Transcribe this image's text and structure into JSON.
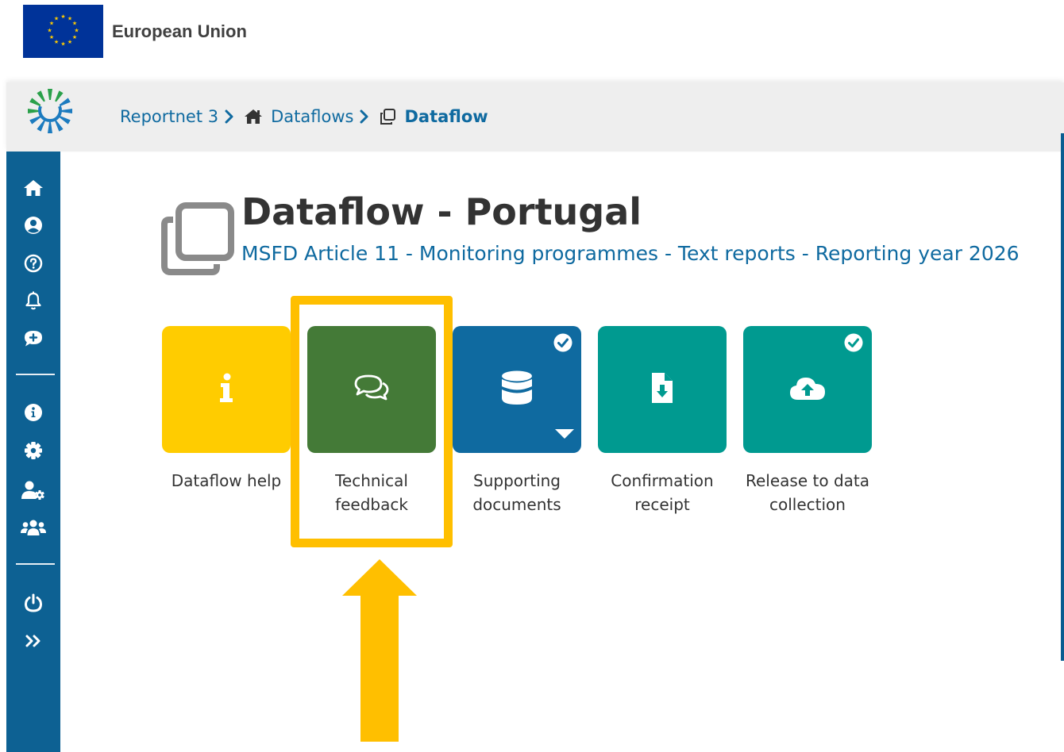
{
  "eu_bar": {
    "title": "European Union"
  },
  "breadcrumb": {
    "items": [
      {
        "label": "Reportnet 3",
        "icon": "none"
      },
      {
        "label": "Dataflows",
        "icon": "home-icon"
      },
      {
        "label": "Dataflow",
        "icon": "copy-icon"
      }
    ]
  },
  "sidebar": {
    "items": [
      {
        "name": "home-icon"
      },
      {
        "name": "user-circle-icon"
      },
      {
        "name": "question-circle-icon"
      },
      {
        "name": "bell-icon"
      },
      {
        "name": "comment-plus-icon"
      },
      {
        "name": "info-circle-icon"
      },
      {
        "name": "gear-icon"
      },
      {
        "name": "user-cog-icon"
      },
      {
        "name": "users-icon"
      },
      {
        "name": "power-icon"
      },
      {
        "name": "double-chevron-right-icon"
      }
    ]
  },
  "page": {
    "title": "Dataflow - Portugal",
    "subtitle": "MSFD Article 11 - Monitoring programmes - Text reports - Reporting year 2026"
  },
  "tiles": [
    {
      "label": "Dataflow help",
      "color": "#ffcc00",
      "icon": "info-icon",
      "check": false,
      "dropdown": false
    },
    {
      "label": "Technical feedback",
      "color": "#447a37",
      "icon": "comments-icon",
      "check": false,
      "dropdown": false
    },
    {
      "label": "Supporting documents",
      "color": "#0f6aa0",
      "icon": "database-icon",
      "check": true,
      "dropdown": true
    },
    {
      "label": "Confirmation receipt",
      "color": "#009a90",
      "icon": "file-download-icon",
      "check": false,
      "dropdown": false
    },
    {
      "label": "Release to data collection",
      "color": "#009a90",
      "icon": "cloud-upload-icon",
      "check": true,
      "dropdown": false
    }
  ],
  "colors": {
    "highlight": "#ffbf00",
    "sidebar": "#0d6193",
    "link": "#0f6aa0"
  }
}
